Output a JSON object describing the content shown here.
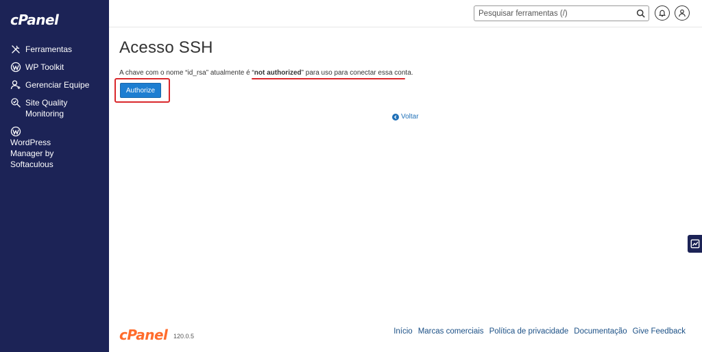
{
  "sidebar": {
    "logo": "cPanel",
    "items": [
      {
        "label": "Ferramentas",
        "icon": "tools-icon"
      },
      {
        "label": "WP Toolkit",
        "icon": "wordpress-icon"
      },
      {
        "label": "Gerenciar Equipe",
        "icon": "user-add-icon"
      },
      {
        "label": "Site Quality Monitoring",
        "icon": "search-check-icon"
      },
      {
        "label": "WordPress Manager by Softaculous",
        "icon": "wordpress-icon"
      }
    ]
  },
  "topbar": {
    "search_placeholder": "Pesquisar ferramentas (/)"
  },
  "main": {
    "title": "Acesso SSH",
    "message_prefix": "A chave com o nome “id_rsa” atualmente é “",
    "message_status": "not authorized",
    "message_suffix": "” para uso para conectar essa conta.",
    "authorize_label": "Authorize",
    "back_label": "Voltar"
  },
  "footer": {
    "logo": "cPanel",
    "version": "120.0.5",
    "links": [
      "Início",
      "Marcas comerciais",
      "Política de privacidade",
      "Documentação",
      "Give Feedback"
    ]
  },
  "colors": {
    "sidebar_bg": "#1c2356",
    "accent_button": "#1d7ed1",
    "annotation_red": "#d9262a",
    "footer_logo": "#ff6c2c"
  }
}
